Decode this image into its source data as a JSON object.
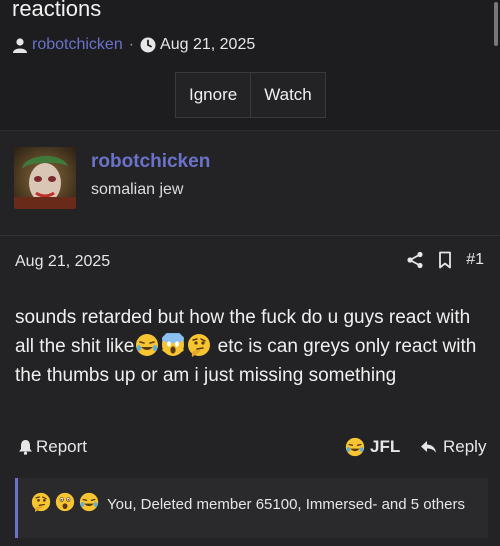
{
  "thread": {
    "title": "reactions",
    "author": "robotchicken",
    "separator": "·",
    "date": "Aug 21, 2025"
  },
  "actions": {
    "ignore_label": "Ignore",
    "watch_label": "Watch"
  },
  "post": {
    "username": "robotchicken",
    "user_title": "somalian jew",
    "date": "Aug 21, 2025",
    "post_number": "#1",
    "body_part1": "sounds retarded but how the fuck do u guys react with all the shit like",
    "body_part2": " etc is can greys only react with the thumbs up or am i just missing something",
    "report_label": "Report",
    "jfl_label": "JFL",
    "reply_label": "Reply",
    "reactions_text": "You, Deleted member 65100, Immersed- and 5 others"
  },
  "colors": {
    "accent": "#6a72c9",
    "background": "#1d1d1f",
    "post_bg": "#232325"
  },
  "icons": [
    "user-icon",
    "clock-icon",
    "share-icon",
    "bookmark-icon",
    "bell-icon",
    "reply-icon",
    "crying-laughing-emoji",
    "screaming-emoji",
    "thinking-emoji",
    "surprised-emoji"
  ]
}
